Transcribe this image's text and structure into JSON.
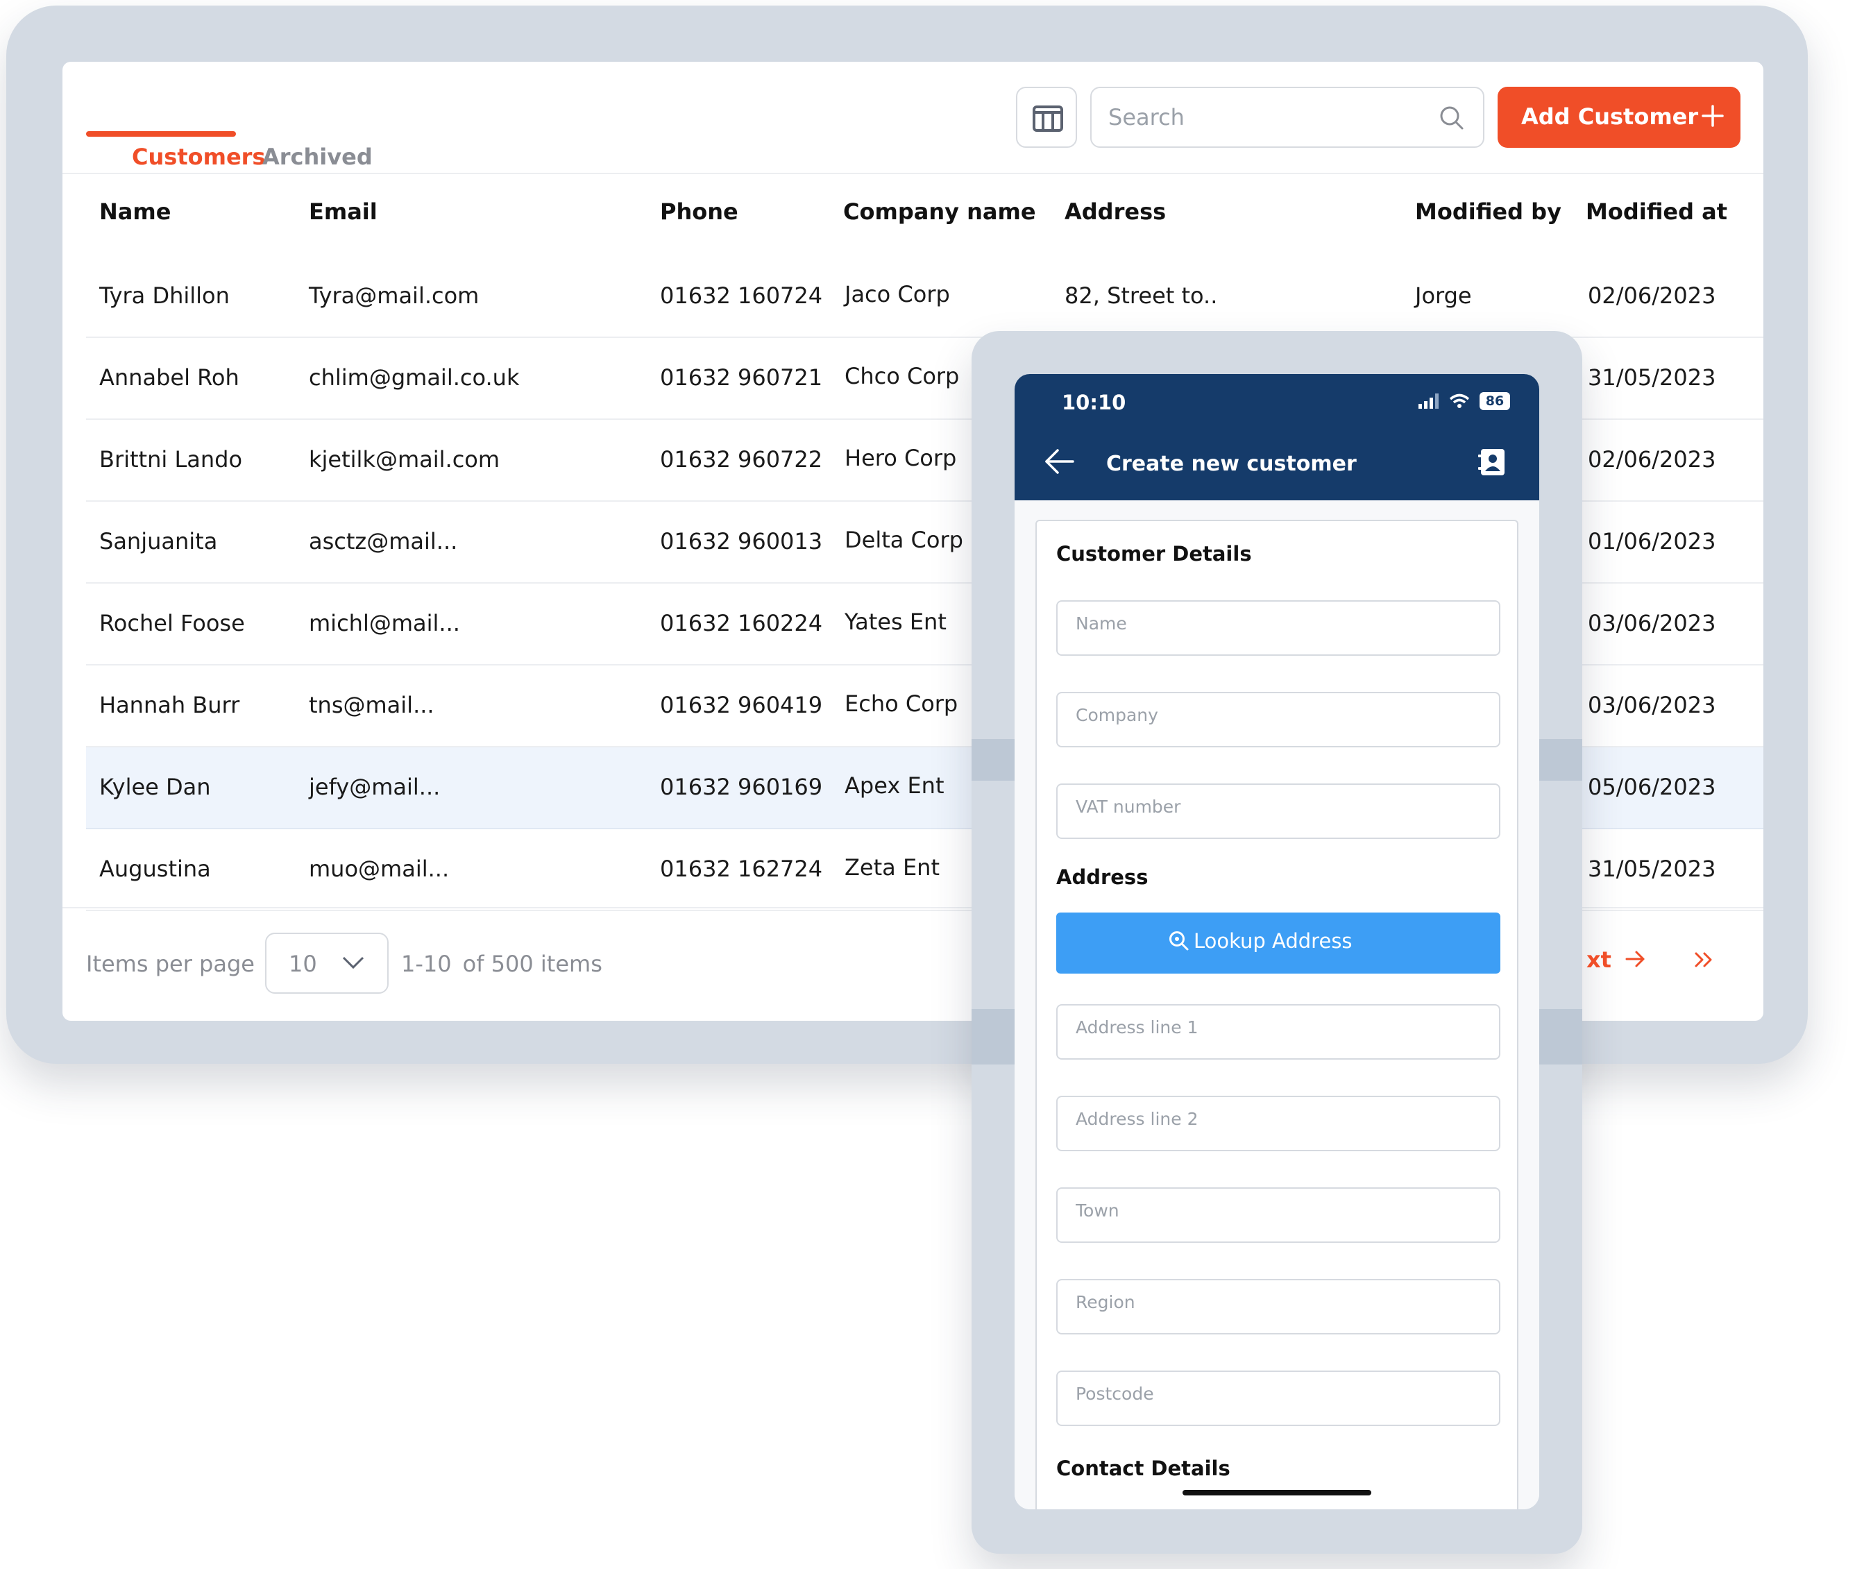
{
  "tabs": [
    {
      "label": "Customers",
      "active": true
    },
    {
      "label": "Archived",
      "active": false
    }
  ],
  "toolbar": {
    "search_placeholder": "Search",
    "add_label": "Add Customer"
  },
  "table": {
    "columns": [
      "Name",
      "Email",
      "Phone",
      "Company name",
      "Address",
      "Modified by",
      "Modified at"
    ],
    "rows": [
      {
        "name": "Tyra Dhillon",
        "email": "Tyra@mail.com",
        "phone": "01632 160724",
        "company": "Jaco Corp",
        "address": "82, Street to..",
        "modified_by": "Jorge",
        "modified_at": "02/06/2023"
      },
      {
        "name": "Annabel Roh",
        "email": "chlim@gmail.co.uk",
        "phone": "01632 960721",
        "company": "Chco Corp",
        "address": "",
        "modified_by": "",
        "modified_at": "31/05/2023"
      },
      {
        "name": "Brittni Lando",
        "email": "kjetilk@mail.com",
        "phone": "01632 960722",
        "company": "Hero Corp",
        "address": "",
        "modified_by": "",
        "modified_at": "02/06/2023"
      },
      {
        "name": "Sanjuanita",
        "email": "asctz@mail...",
        "phone": "01632 960013",
        "company": "Delta Corp",
        "address": "",
        "modified_by": "",
        "modified_at": "01/06/2023"
      },
      {
        "name": "Rochel Foose",
        "email": "michl@mail...",
        "phone": "01632 160224",
        "company": "Yates Ent",
        "address": "",
        "modified_by": "",
        "modified_at": "03/06/2023"
      },
      {
        "name": "Hannah Burr",
        "email": "tns@mail...",
        "phone": "01632 960419",
        "company": "Echo Corp",
        "address": "",
        "modified_by": "",
        "modified_at": "03/06/2023"
      },
      {
        "name": "Kylee Dan",
        "email": "jefy@mail...",
        "phone": "01632 960169",
        "company": "Apex Ent",
        "address": "",
        "modified_by": "",
        "modified_at": "05/06/2023",
        "highlighted": true
      },
      {
        "name": "Augustina",
        "email": "muo@mail...",
        "phone": "01632 162724",
        "company": "Zeta Ent",
        "address": "",
        "modified_by": "",
        "modified_at": "31/05/2023"
      }
    ]
  },
  "pagination": {
    "items_per_page_label": "Items per page",
    "per_page_value": "10",
    "range": "1-10",
    "total": "of 500 items",
    "next_visible": "xt"
  },
  "mobile": {
    "status_time": "10:10",
    "battery": "86",
    "title": "Create new customer",
    "sections": {
      "customer": "Customer Details",
      "address": "Address",
      "contact": "Contact Details"
    },
    "fields": {
      "name": "Name",
      "company": "Company",
      "vat": "VAT number",
      "address1": "Address line 1",
      "address2": "Address line 2",
      "town": "Town",
      "region": "Region",
      "postcode": "Postcode"
    },
    "lookup_label": "Lookup Address"
  },
  "colors": {
    "accent": "#f04e28",
    "mobile_header": "#153b6a",
    "lookup_button": "#3d9ef5",
    "frame": "#d3dae3",
    "highlight_row": "#eef4fc"
  }
}
